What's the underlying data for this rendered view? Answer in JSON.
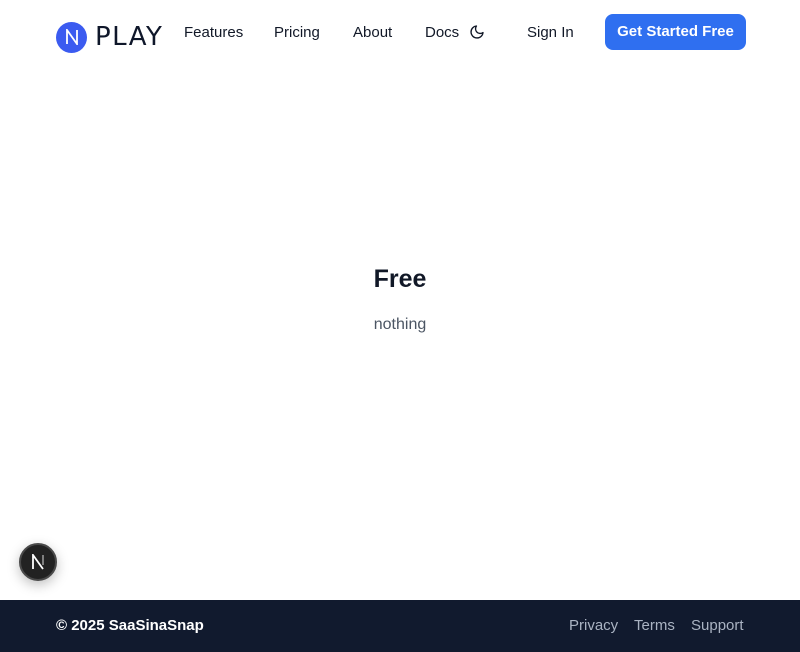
{
  "header": {
    "logo": {
      "mark_icon": "n-logo-icon",
      "wordmark": "PLAY",
      "brand_color": "#3b5bf0"
    },
    "nav": [
      {
        "label": "Features"
      },
      {
        "label": "Pricing"
      },
      {
        "label": "About"
      },
      {
        "label": "Docs"
      }
    ],
    "theme_toggle_icon": "moon-icon",
    "sign_in_label": "Sign In",
    "cta_label": "Get Started Free",
    "cta_color": "#2f6ff0"
  },
  "main": {
    "title": "Free",
    "subtitle": "nothing"
  },
  "floating_badge_icon": "n-badge-icon",
  "footer": {
    "copyright": "© 2025 SaaSinaSnap",
    "links": [
      {
        "label": "Privacy"
      },
      {
        "label": "Terms"
      },
      {
        "label": "Support"
      }
    ],
    "background_color": "#111a2e"
  }
}
